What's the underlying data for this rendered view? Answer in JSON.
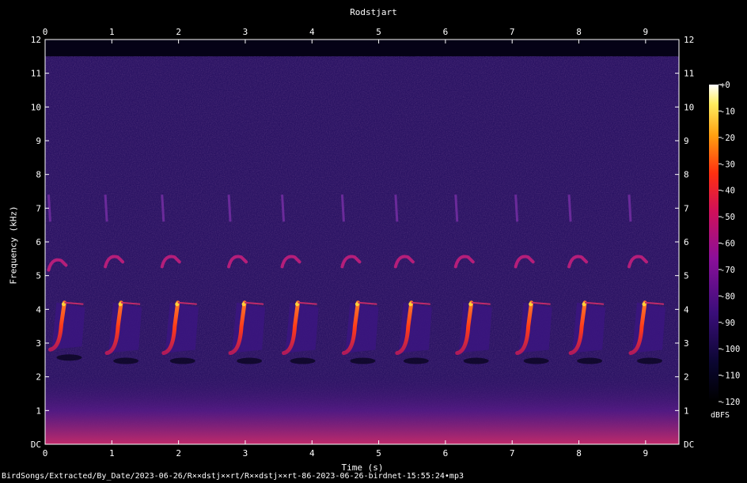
{
  "title": "Rodstjart",
  "footer_path": "BirdSongs/Extracted/By_Date/2023-06-26/R××dstj××rt/R××dstj××rt-86-2023-06-26-birdnet-15:55:24•mp3",
  "chart_data": {
    "type": "heatmap",
    "title": "Rodstjart",
    "xlabel": "Time (s)",
    "ylabel": "Frequency (kHz)",
    "xlim": [
      0,
      9.5
    ],
    "ylim": [
      0,
      12
    ],
    "x_ticks": [
      "0",
      "1",
      "2",
      "3",
      "4",
      "5",
      "6",
      "7",
      "8",
      "9"
    ],
    "y_ticks": [
      "DC",
      "1",
      "2",
      "3",
      "4",
      "5",
      "6",
      "7",
      "8",
      "9",
      "10",
      "11",
      "12"
    ],
    "colorbar": {
      "unit": "dBFS",
      "range": [
        -120,
        0
      ],
      "ticks": [
        "+0",
        "-10",
        "-20",
        "-30",
        "-40",
        "-50",
        "-60",
        "-70",
        "-80",
        "-90",
        "-100",
        "-110",
        "-120"
      ]
    },
    "calls": [
      {
        "time_s": 0.1,
        "freq_low_khz": 2.9,
        "freq_high_khz": 4.2,
        "harmonic_khz": 5.4
      },
      {
        "time_s": 0.95,
        "freq_low_khz": 2.8,
        "freq_high_khz": 4.2,
        "harmonic_khz": 5.5
      },
      {
        "time_s": 1.8,
        "freq_low_khz": 2.8,
        "freq_high_khz": 4.2,
        "harmonic_khz": 5.5
      },
      {
        "time_s": 2.8,
        "freq_low_khz": 2.8,
        "freq_high_khz": 4.2,
        "harmonic_khz": 5.5
      },
      {
        "time_s": 3.6,
        "freq_low_khz": 2.8,
        "freq_high_khz": 4.2,
        "harmonic_khz": 5.5
      },
      {
        "time_s": 4.5,
        "freq_low_khz": 2.8,
        "freq_high_khz": 4.2,
        "harmonic_khz": 5.5
      },
      {
        "time_s": 5.3,
        "freq_low_khz": 2.8,
        "freq_high_khz": 4.2,
        "harmonic_khz": 5.5
      },
      {
        "time_s": 6.2,
        "freq_low_khz": 2.8,
        "freq_high_khz": 4.2,
        "harmonic_khz": 5.5
      },
      {
        "time_s": 7.1,
        "freq_low_khz": 2.8,
        "freq_high_khz": 4.2,
        "harmonic_khz": 5.5
      },
      {
        "time_s": 7.9,
        "freq_low_khz": 2.8,
        "freq_high_khz": 4.2,
        "harmonic_khz": 5.5
      },
      {
        "time_s": 8.8,
        "freq_low_khz": 2.8,
        "freq_high_khz": 4.2,
        "harmonic_khz": 5.5
      }
    ],
    "colors": {
      "background": "#000000",
      "noise": "#2a1363",
      "low_band": "#8a1a86",
      "call": "#ff3a1a",
      "peak": "#ffd23a"
    }
  }
}
